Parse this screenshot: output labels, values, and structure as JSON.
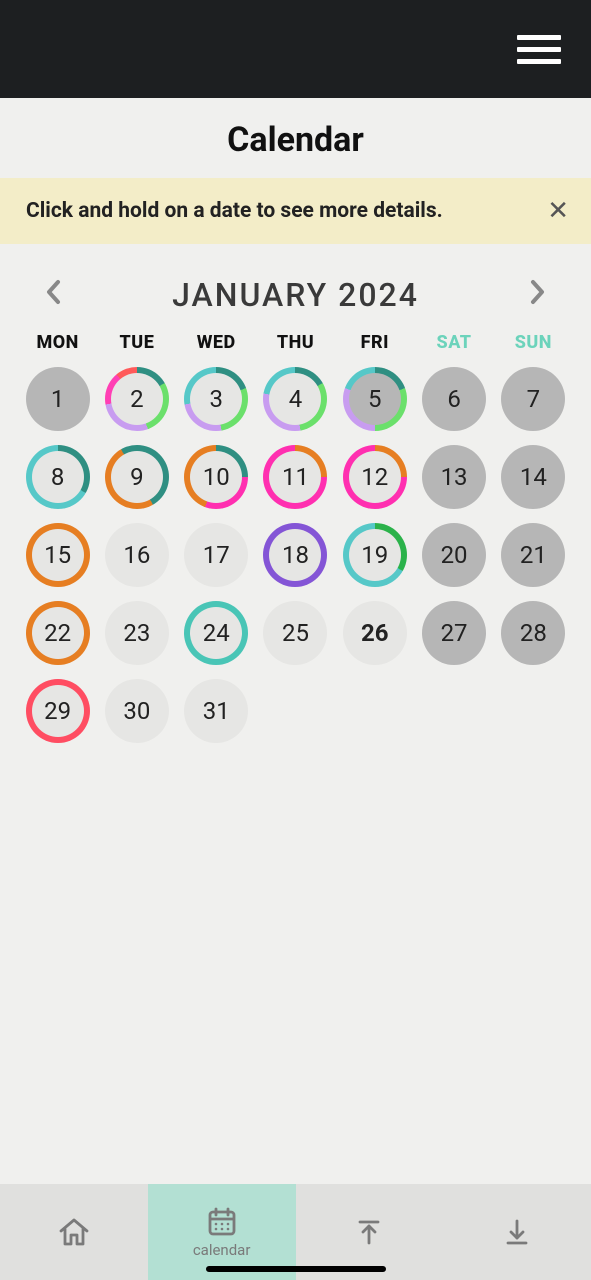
{
  "title": "Calendar",
  "hint": {
    "text": "Click and hold on a date to see more details.",
    "close": "✕"
  },
  "monthLabel": "JANUARY 2024",
  "dow": [
    "MON",
    "TUE",
    "WED",
    "THU",
    "FRI",
    "SAT",
    "SUN"
  ],
  "days": [
    {
      "n": 1,
      "fill": "dark"
    },
    {
      "n": 2,
      "ring": "conic-gradient(#2f8f82 0 60deg,#6be06b 60deg 160deg,#c89cf0 160deg 260deg,#ff3fb4 260deg 320deg,#ff5a5a 320deg 360deg)",
      "inner": "light"
    },
    {
      "n": 3,
      "ring": "conic-gradient(#2f8f82 0 70deg,#6be06b 70deg 170deg,#c89cf0 170deg 260deg,#56c8c8 260deg 360deg)",
      "inner": "light"
    },
    {
      "n": 4,
      "ring": "conic-gradient(#2f8f82 0 60deg,#6be06b 60deg 170deg,#c89cf0 170deg 280deg,#56c8c8 280deg 360deg)",
      "inner": "light"
    },
    {
      "n": 5,
      "ring": "conic-gradient(#2f8f82 0 70deg,#6be06b 70deg 180deg,#c89cf0 180deg 290deg,#56c8c8 290deg 360deg)",
      "inner": "dark"
    },
    {
      "n": 6,
      "fill": "dark"
    },
    {
      "n": 7,
      "fill": "dark"
    },
    {
      "n": 8,
      "ring": "conic-gradient(#2f8f82 0 120deg,#56c8c8 120deg 360deg)",
      "inner": "light"
    },
    {
      "n": 9,
      "ring": "conic-gradient(#2f8f82 0 150deg,#e67e22 150deg 330deg,#2f8f82 330deg 360deg)",
      "inner": "light"
    },
    {
      "n": 10,
      "ring": "conic-gradient(#2f8f82 0 90deg,#ff2fb0 90deg 200deg,#e67e22 200deg 360deg)",
      "inner": "light"
    },
    {
      "n": 11,
      "ring": "conic-gradient(#e67e22 0 90deg,#ff2fb0 90deg 360deg)",
      "inner": "light"
    },
    {
      "n": 12,
      "ring": "conic-gradient(#e67e22 0 90deg,#ff2fb0 90deg 360deg)",
      "inner": "light"
    },
    {
      "n": 13,
      "fill": "dark"
    },
    {
      "n": 14,
      "fill": "dark"
    },
    {
      "n": 15,
      "ring": "#e67e22",
      "inner": "light"
    },
    {
      "n": 16,
      "fill": "light"
    },
    {
      "n": 17,
      "fill": "light"
    },
    {
      "n": 18,
      "ring": "#8455d6",
      "inner": "light"
    },
    {
      "n": 19,
      "ring": "conic-gradient(#2bb24a 0 120deg,#56c8c8 120deg 360deg)",
      "inner": "light"
    },
    {
      "n": 20,
      "fill": "dark"
    },
    {
      "n": 21,
      "fill": "dark"
    },
    {
      "n": 22,
      "ring": "#e67e22",
      "inner": "light"
    },
    {
      "n": 23,
      "fill": "light"
    },
    {
      "n": 24,
      "ring": "#49c5b6",
      "inner": "light"
    },
    {
      "n": 25,
      "fill": "light"
    },
    {
      "n": 26,
      "fill": "light",
      "today": true
    },
    {
      "n": 27,
      "fill": "dark"
    },
    {
      "n": 28,
      "fill": "dark"
    },
    {
      "n": 29,
      "ring": "#ff4d62",
      "inner": "light"
    },
    {
      "n": 30,
      "fill": "light"
    },
    {
      "n": 31,
      "fill": "light"
    }
  ],
  "tabs": {
    "calendarLabel": "calendar"
  }
}
